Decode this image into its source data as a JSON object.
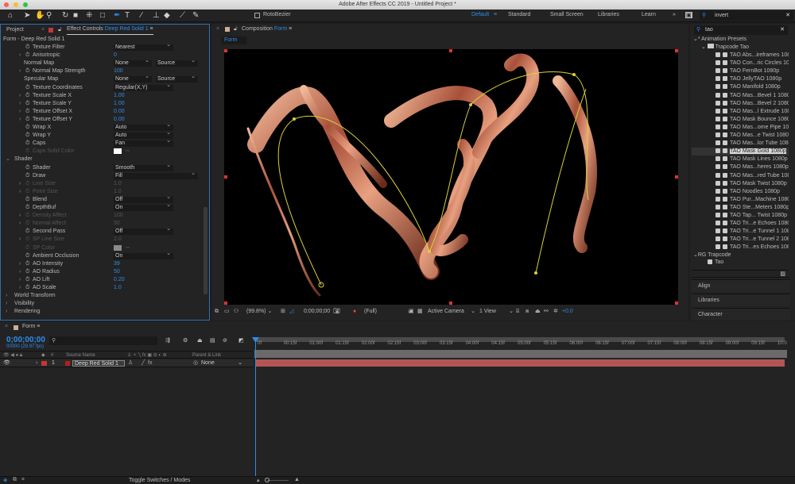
{
  "window": {
    "title": "Adobe After Effects CC 2019 - Untitled Project *"
  },
  "toolbar": {
    "rotobezier": "RotoBezier",
    "tools": [
      "home-icon",
      "selection-icon",
      "hand-icon",
      "zoom-icon",
      "rotate-icon",
      "camera-icon",
      "pan-behind-icon",
      "rectangle-icon",
      "pen-icon",
      "type-icon",
      "brush-icon",
      "clone-stamp-icon",
      "eraser-icon",
      "roto-brush-icon",
      "puppet-pin-icon"
    ]
  },
  "workspaces": {
    "items": [
      "Default",
      "Standard",
      "Small Screen",
      "Libraries",
      "Learn"
    ],
    "active": "Default",
    "more": "»",
    "search_value": "invert"
  },
  "left_panel": {
    "tab_project": "Project",
    "tab_effect_prefix": "Effect Controls",
    "tab_effect_layer": "Deep Red Solid 1",
    "subtitle": "Form - Deep Red Solid 1",
    "rows": [
      {
        "label": "Texture Filter",
        "indent": 2,
        "sw": true,
        "type": "dd",
        "value": "Nearest"
      },
      {
        "label": "Anisotropic",
        "indent": 2,
        "sw": true,
        "tw": true,
        "type": "num",
        "value": "0"
      },
      {
        "label": "Normal Map",
        "indent": 1,
        "type": "dd2",
        "value": "None",
        "value2": "Source"
      },
      {
        "label": "Normal Map Strength",
        "indent": 2,
        "sw": true,
        "tw": true,
        "type": "num",
        "value": "100"
      },
      {
        "label": "Specular Map",
        "indent": 1,
        "type": "dd2",
        "value": "None",
        "value2": "Source"
      },
      {
        "label": "Texture Coordinates",
        "indent": 2,
        "sw": true,
        "type": "dd",
        "value": "Regular(X,Y)"
      },
      {
        "label": "Texture Scale X",
        "indent": 2,
        "sw": true,
        "tw": true,
        "type": "num",
        "value": "1.00"
      },
      {
        "label": "Texture Scale Y",
        "indent": 2,
        "sw": true,
        "tw": true,
        "type": "num",
        "value": "1.00"
      },
      {
        "label": "Texture Offset X",
        "indent": 2,
        "sw": true,
        "tw": true,
        "type": "num",
        "value": "0.00"
      },
      {
        "label": "Texture Offset Y",
        "indent": 2,
        "sw": true,
        "tw": true,
        "type": "num",
        "value": "0.00"
      },
      {
        "label": "Wrap X",
        "indent": 2,
        "sw": true,
        "type": "dd",
        "value": "Auto"
      },
      {
        "label": "Wrap Y",
        "indent": 2,
        "sw": true,
        "type": "dd",
        "value": "Auto"
      },
      {
        "label": "Caps",
        "indent": 2,
        "sw": true,
        "type": "dd",
        "value": "Fan"
      },
      {
        "label": "Caps Solid Color",
        "indent": 2,
        "sw": true,
        "dis": true,
        "type": "color",
        "value": "#ffffff"
      },
      {
        "label": "Shader",
        "indent": 0,
        "open": true,
        "type": "none"
      },
      {
        "label": "Shader",
        "indent": 2,
        "sw": true,
        "type": "dd",
        "value": "Smooth"
      },
      {
        "label": "Draw",
        "indent": 2,
        "sw": true,
        "type": "ddw",
        "value": "Fill"
      },
      {
        "label": "Line Size",
        "indent": 2,
        "sw": true,
        "tw": true,
        "dis": true,
        "type": "num",
        "value": "1.0"
      },
      {
        "label": "Point Size",
        "indent": 2,
        "sw": true,
        "tw": true,
        "dis": true,
        "type": "num",
        "value": "1.0"
      },
      {
        "label": "Blend",
        "indent": 2,
        "sw": true,
        "type": "dd",
        "value": "Off"
      },
      {
        "label": "DepthBuf",
        "indent": 2,
        "sw": true,
        "type": "dd",
        "value": "On"
      },
      {
        "label": "Density Affect",
        "indent": 2,
        "sw": true,
        "tw": true,
        "dis": true,
        "type": "num",
        "value": "100"
      },
      {
        "label": "Normal Affect",
        "indent": 2,
        "sw": true,
        "tw": true,
        "dis": true,
        "type": "num",
        "value": "50"
      },
      {
        "label": "Second Pass",
        "indent": 2,
        "sw": true,
        "type": "dd",
        "value": "Off"
      },
      {
        "label": "SP Line Size",
        "indent": 2,
        "sw": true,
        "tw": true,
        "dis": true,
        "type": "num",
        "value": "2.0"
      },
      {
        "label": "SP Color",
        "indent": 2,
        "sw": true,
        "dis": true,
        "type": "color",
        "value": "#8a8a8a"
      },
      {
        "label": "Ambient Occlusion",
        "indent": 2,
        "sw": true,
        "type": "dd",
        "value": "On"
      },
      {
        "label": "AO Intensity",
        "indent": 2,
        "sw": true,
        "tw": true,
        "type": "num",
        "value": "39"
      },
      {
        "label": "AO Radius",
        "indent": 2,
        "sw": true,
        "tw": true,
        "type": "num",
        "value": "50"
      },
      {
        "label": "AO Lift",
        "indent": 2,
        "sw": true,
        "tw": true,
        "type": "num",
        "value": "0.20"
      },
      {
        "label": "AO Scale",
        "indent": 2,
        "sw": true,
        "tw": true,
        "type": "num",
        "value": "1.0"
      },
      {
        "label": "World Transform",
        "indent": 0,
        "tw": true,
        "type": "none"
      },
      {
        "label": "Visibility",
        "indent": 0,
        "tw": true,
        "type": "none"
      },
      {
        "label": "Rendering",
        "indent": 0,
        "tw": true,
        "type": "none"
      }
    ]
  },
  "comp_panel": {
    "tab_prefix": "Composition",
    "tab_name": "Form",
    "subtab": "Form",
    "viewer_toolbar": {
      "zoom": "(99.8%)",
      "timecode": "0;00;00;00",
      "resolution": "(Full)",
      "camera": "Active Camera",
      "views": "1 View",
      "exposure": "+0.0"
    }
  },
  "right_panel": {
    "search_value": "tao",
    "root": "* Animation Presets",
    "folder": "Trapcode Tao",
    "presets": [
      "TAO Abs...ireframes 1080p",
      "TAO Con...ric Circles 1080p",
      "TAO FernBot 1080p",
      "TAO JellyTAO 1080p",
      "TAO Manifold 1080p",
      "TAO Mas...Bevel 1 1080p",
      "TAO Mas...Bevel 2 1080p",
      "TAO Mas...l Extrude 1080p",
      "TAO Mask Bounce 1080p",
      "TAO Mas...ome Pipe 1080p",
      "TAO Mas...e Twist 1080p",
      "TAO Mas...lor Tube 1080p",
      "TAO Mask Gold 1080p",
      "TAO Mask Lines 1080p",
      "TAO Mas...heres 1080p",
      "TAO Mas...red Tube 1080p",
      "TAO Mask Twist 1080p",
      "TAO Noodles 1080p",
      "TAO Pur...Machine 1080p",
      "TAO Ste...Meters 1080p",
      "TAO Tap... Twist 1080p",
      "TAO Tri...e Echoes 1080p",
      "TAO Tri...e Tunnel 1 1080p",
      "TAO Tri...e Tunnel 2 1080p",
      "TAO Tri...es Echoes 1080p"
    ],
    "selected": "TAO Mask Gold 1080p",
    "group2": "RG Trapcode",
    "group2_item": "Tao",
    "sections": [
      "Align",
      "Libraries",
      "Character"
    ]
  },
  "timeline": {
    "tab": "Form",
    "timecode": "0;00;00;00",
    "frame_info": "00000 (29.97 fps)",
    "col_num": "#",
    "col_source": "Source Name",
    "col_parent": "Parent & Link",
    "layer": {
      "number": "1",
      "name": "Deep Red Solid 1",
      "parent": "None",
      "color": "#b83030"
    },
    "ruler": [
      "0f",
      "00:15f",
      "01:00f",
      "01:15f",
      "02:00f",
      "02:15f",
      "03:00f",
      "03:15f",
      "04:00f",
      "04:15f",
      "05:00f",
      "05:15f",
      "06:00f",
      "06:15f",
      "07:00f",
      "07:15f",
      "08:00f",
      "08:15f",
      "09:00f",
      "09:15f",
      "10:0"
    ],
    "toggle_label": "Toggle Switches / Modes"
  },
  "colors": {
    "accent": "#2d8ceb",
    "panel": "#232323",
    "layer_bar": "#b35555",
    "path": "#d8d23a",
    "ribbon": "#c8704f"
  }
}
